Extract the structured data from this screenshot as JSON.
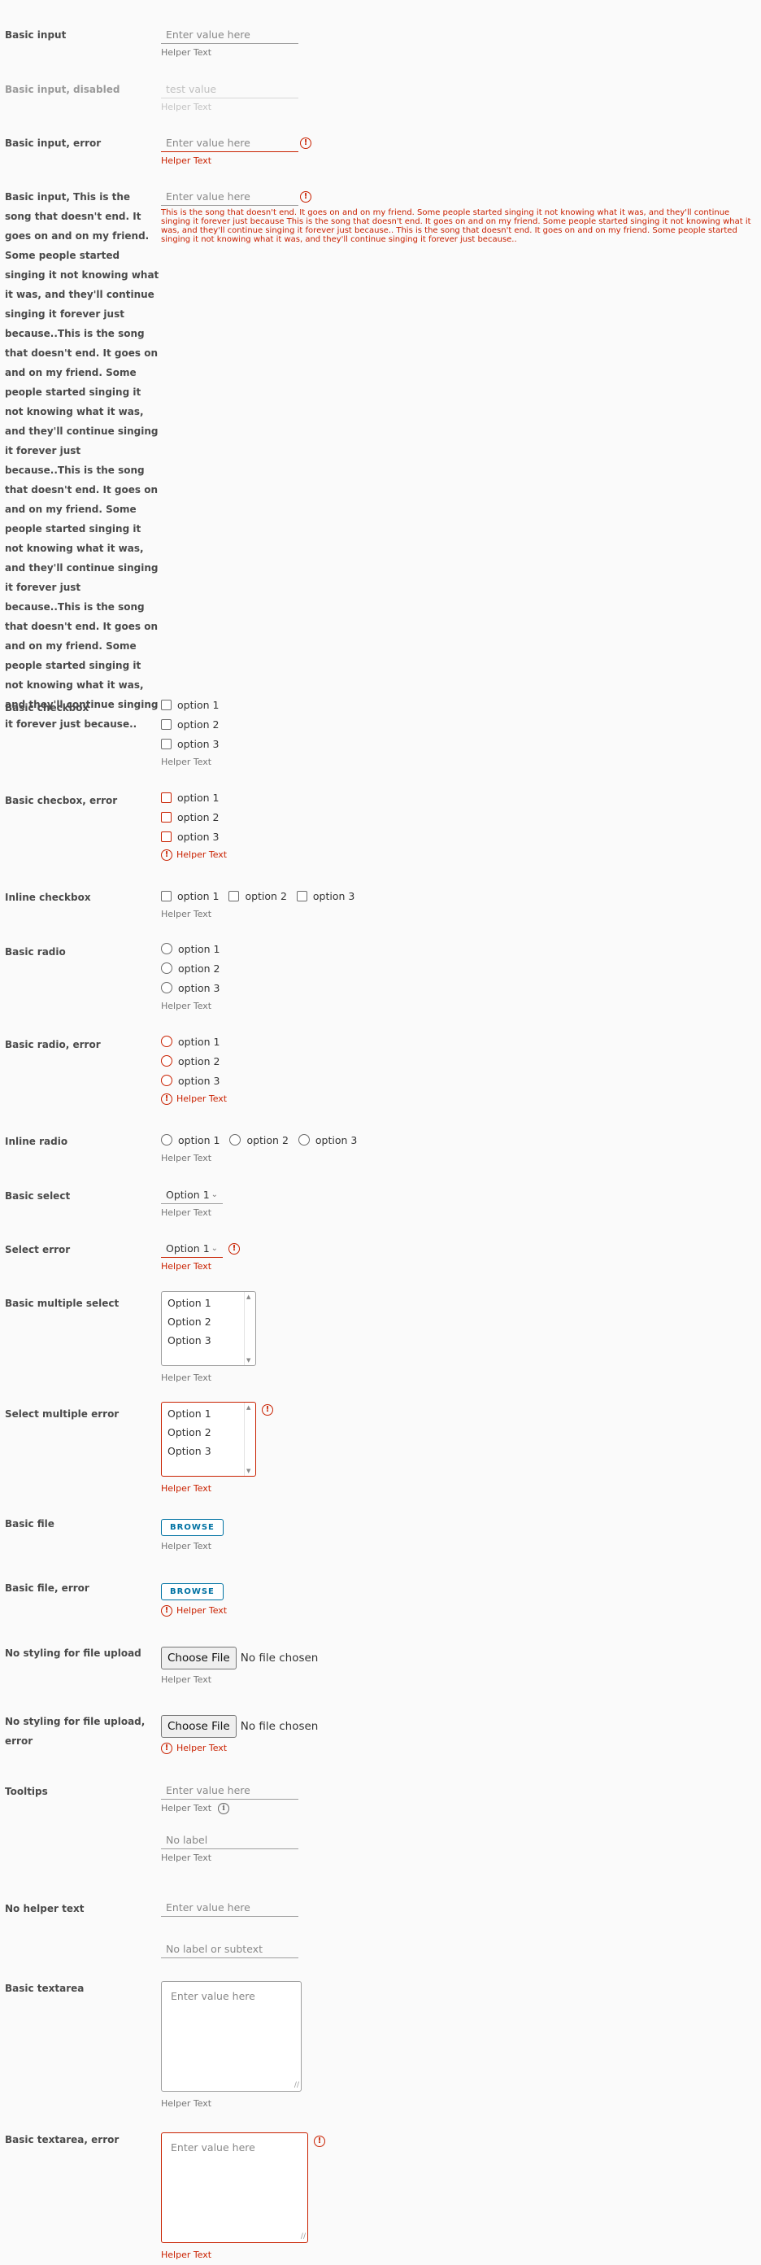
{
  "fields": {
    "basic_input": {
      "label": "Basic input",
      "placeholder": "Enter value here",
      "helper": "Helper Text"
    },
    "basic_input_disabled": {
      "label": "Basic input, disabled",
      "value": "test value",
      "helper": "Helper Text"
    },
    "basic_input_error": {
      "label": "Basic input, error",
      "placeholder": "Enter value here",
      "helper": "Helper Text"
    },
    "long_input": {
      "label": "Basic input, This is the song that doesn't end. It goes on and on my friend. Some people started singing it not knowing what it was, and they'll continue singing it forever just because..This is the song that doesn't end. It goes on and on my friend. Some people started singing it not knowing what it was, and they'll continue singing it forever just because..This is the song that doesn't end. It goes on and on my friend. Some people started singing it not knowing what it was, and they'll continue singing it forever just because..This is the song that doesn't end. It goes on and on my friend. Some people started singing it not knowing what it was, and they'll continue singing it forever just because..",
      "placeholder": "Enter value here",
      "error": "This is the song that doesn't end. It goes on and on my friend. Some people started singing it not knowing what it was, and they'll continue singing it forever just because This is the song that doesn't end. It goes on and on my friend. Some people started singing it not knowing what it was, and they'll continue singing it forever just because.. This is the song that doesn't end. It goes on and on my friend. Some people started singing it not knowing what it was, and they'll continue singing it forever just because.."
    },
    "basic_checkbox": {
      "label": "Basic checkbox",
      "options": [
        "option 1",
        "option 2",
        "option 3"
      ],
      "helper": "Helper Text"
    },
    "checkbox_error": {
      "label": "Basic checbox, error",
      "options": [
        "option 1",
        "option 2",
        "option 3"
      ],
      "helper": "Helper Text"
    },
    "inline_checkbox": {
      "label": "Inline checkbox",
      "options": [
        "option 1",
        "option 2",
        "option 3"
      ],
      "helper": "Helper Text"
    },
    "basic_radio": {
      "label": "Basic radio",
      "options": [
        "option 1",
        "option 2",
        "option 3"
      ],
      "helper": "Helper Text"
    },
    "radio_error": {
      "label": "Basic radio, error",
      "options": [
        "option 1",
        "option 2",
        "option 3"
      ],
      "helper": "Helper Text"
    },
    "inline_radio": {
      "label": "Inline radio",
      "options": [
        "option 1",
        "option 2",
        "option 3"
      ],
      "helper": "Helper Text"
    },
    "basic_select": {
      "label": "Basic select",
      "value": "Option 1",
      "helper": "Helper Text"
    },
    "select_error": {
      "label": "Select error",
      "value": "Option 1",
      "helper": "Helper Text"
    },
    "multi_select": {
      "label": "Basic multiple select",
      "options": [
        "Option 1",
        "Option 2",
        "Option 3"
      ],
      "helper": "Helper Text"
    },
    "multi_select_error": {
      "label": "Select multiple error",
      "options": [
        "Option 1",
        "Option 2",
        "Option 3"
      ],
      "helper": "Helper Text"
    },
    "basic_file": {
      "label": "Basic file",
      "button": "BROWSE",
      "helper": "Helper Text"
    },
    "basic_file_error": {
      "label": "Basic file, error",
      "button": "BROWSE",
      "helper": "Helper Text"
    },
    "native_file": {
      "label": "No styling for file upload",
      "button": "Choose File",
      "status": "No file chosen",
      "helper": "Helper Text"
    },
    "native_file_error": {
      "label": "No styling for file upload, error",
      "button": "Choose File",
      "status": "No file chosen",
      "helper": "Helper Text"
    },
    "tooltips": {
      "label": "Tooltips",
      "placeholder": "Enter value here",
      "helper": "Helper Text",
      "placeholder2": "No label",
      "helper2": "Helper Text"
    },
    "no_helper": {
      "label": "No helper text",
      "placeholder": "Enter value here",
      "placeholder2": "No label or subtext"
    },
    "textarea": {
      "label": "Basic textarea",
      "placeholder": "Enter value here",
      "helper": "Helper Text"
    },
    "textarea_error": {
      "label": "Basic textarea, error",
      "placeholder": "Enter value here",
      "helper": "Helper Text"
    }
  },
  "colors": {
    "error": "#c92100",
    "primary": "#0072a3",
    "background": "#fafafa"
  },
  "icons": {
    "error": "exclamation-circle-icon",
    "info": "info-circle-icon"
  }
}
